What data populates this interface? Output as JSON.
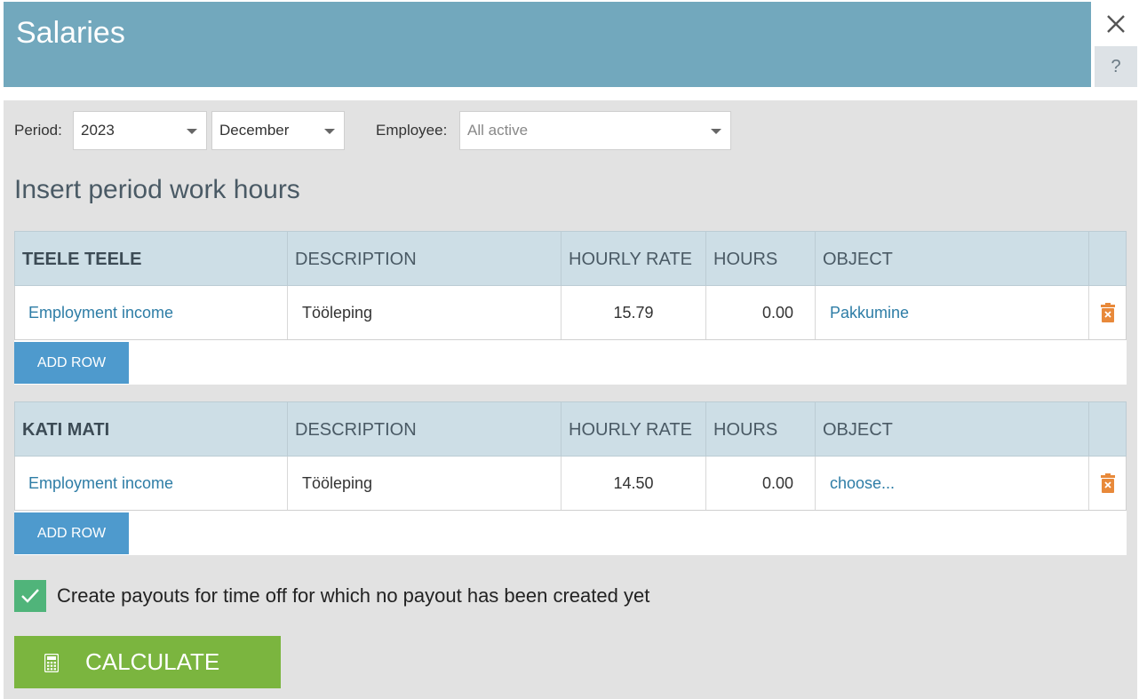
{
  "header": {
    "title": "Salaries",
    "close_icon": "close-icon",
    "help_label": "?"
  },
  "filters": {
    "period_label": "Period:",
    "year": "2023",
    "month": "December",
    "employee_label": "Employee:",
    "employee_placeholder": "All active"
  },
  "section_title": "Insert period work hours",
  "columns": {
    "description": "DESCRIPTION",
    "hourly_rate": "HOURLY RATE",
    "hours": "HOURS",
    "object": "OBJECT"
  },
  "employees": [
    {
      "name": "TEELE TEELE",
      "rows": [
        {
          "type": "Employment income",
          "description": "Tööleping",
          "hourly_rate": "15.79",
          "hours": "0.00",
          "object": "Pakkumine"
        }
      ],
      "add_row_label": "ADD ROW"
    },
    {
      "name": "KATI MATI",
      "rows": [
        {
          "type": "Employment income",
          "description": "Tööleping",
          "hourly_rate": "14.50",
          "hours": "0.00",
          "object": "choose..."
        }
      ],
      "add_row_label": "ADD ROW"
    }
  ],
  "payout_option": {
    "checked": true,
    "label": "Create payouts for time off for which no payout has been created yet"
  },
  "calculate_button": {
    "label": "CALCULATE",
    "icon": "calculator-icon"
  },
  "colors": {
    "header": "#72a8bd",
    "add_row": "#4e9acd",
    "calculate": "#7bb53f",
    "checkbox": "#50b47a",
    "trash": "#e8893a",
    "link": "#2e7da6"
  }
}
